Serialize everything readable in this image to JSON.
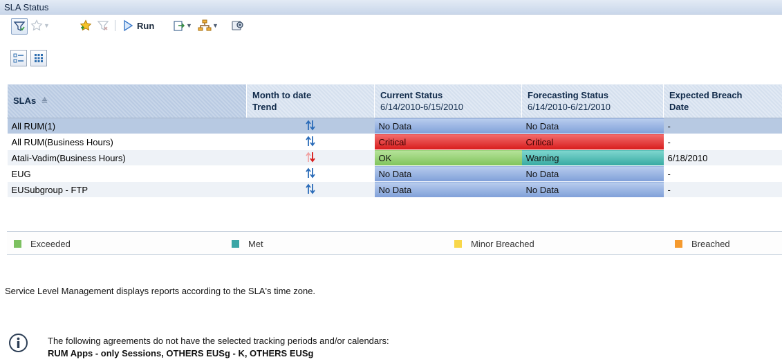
{
  "window": {
    "title": "SLA Status"
  },
  "toolbar": {
    "run_label": "Run",
    "icons": [
      "filter-icon",
      "favorites-icon",
      "add-favorite-icon",
      "remove-filter-icon",
      "run-icon",
      "export-icon",
      "tree-icon",
      "settings-icon"
    ]
  },
  "view_buttons": [
    "list-view-icon",
    "grid-view-icon"
  ],
  "table": {
    "columns": [
      {
        "label": "SLAs",
        "sub": "",
        "sort": "asc"
      },
      {
        "label": "Month to date",
        "sub": "Trend"
      },
      {
        "label": "Current Status",
        "sub": "6/14/2010-6/15/2010"
      },
      {
        "label": "Forecasting Status",
        "sub": "6/14/2010-6/21/2010"
      },
      {
        "label": "Expected Breach",
        "sub": "Date"
      }
    ],
    "rows": [
      {
        "name": "All RUM(1)",
        "trend": "up-down",
        "current": "No Data",
        "current_state": "nodata",
        "forecast": "No Data",
        "forecast_state": "nodata",
        "breach": "-",
        "selected": true
      },
      {
        "name": "All RUM(Business Hours)",
        "trend": "up-down",
        "current": "Critical",
        "current_state": "critical",
        "forecast": "Critical",
        "forecast_state": "critical",
        "breach": "-"
      },
      {
        "name": "Atali-Vadim(Business Hours)",
        "trend": "down",
        "current": "OK",
        "current_state": "ok",
        "forecast": "Warning",
        "forecast_state": "warning",
        "breach": "6/18/2010"
      },
      {
        "name": "EUG",
        "trend": "up-down",
        "current": "No Data",
        "current_state": "nodata",
        "forecast": "No Data",
        "forecast_state": "nodata",
        "breach": "-"
      },
      {
        "name": "EUSubgroup - FTP",
        "trend": "up-down",
        "current": "No Data",
        "current_state": "nodata",
        "forecast": "No Data",
        "forecast_state": "nodata",
        "breach": "-"
      }
    ]
  },
  "legend": [
    {
      "label": "Exceeded",
      "color": "#7cc060"
    },
    {
      "label": "Met",
      "color": "#3aa6a6"
    },
    {
      "label": "Minor Breached",
      "color": "#f8d74a"
    },
    {
      "label": "Breached",
      "color": "#f59a2e"
    }
  ],
  "note": "Service Level Management displays reports according to the SLA's time zone.",
  "info": {
    "line1": "The following agreements do not have the selected tracking periods and/or calendars:",
    "line2": "RUM Apps - only Sessions, OTHERS EUSg - K, OTHERS EUSg"
  }
}
